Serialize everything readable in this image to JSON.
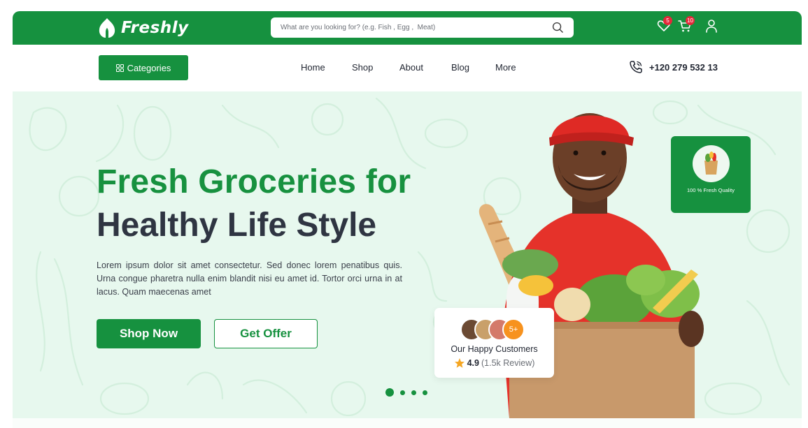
{
  "brand": {
    "name": "Freshly",
    "primary_color": "#16913f",
    "dark_text": "#2f3542",
    "badge_color": "#e5283a",
    "accent_orange": "#f7921e"
  },
  "header": {
    "search": {
      "placeholder": "What are you looking for? (e.g. Fish , Egg ,  Meat)",
      "icon": "search-icon"
    },
    "wishlist": {
      "icon": "heart-icon",
      "count": "5"
    },
    "cart": {
      "icon": "cart-icon",
      "count": "10"
    },
    "account": {
      "icon": "user-icon"
    }
  },
  "nav": {
    "categories_label": "Categories",
    "categories_icon": "grid-icon",
    "links": [
      "Home",
      "Shop",
      "About",
      "Blog",
      "More"
    ],
    "phone": "+120 279 532 13",
    "phone_icon": "phone-icon"
  },
  "hero": {
    "headline_line1": "Fresh Groceries for",
    "headline_line2": "Healthy Life Style",
    "description": "Lorem ipsum dolor sit amet consectetur. Sed donec lorem penatibus quis. Urna congue pharetra nulla enim blandit nisi eu amet id. Tortor orci urna in at lacus. Quam maecenas amet",
    "shop_now_label": "Shop Now",
    "get_offer_label": "Get Offer",
    "slides_count": 4,
    "active_slide": 1
  },
  "quality_badge": {
    "text": "100 % Fresh Quality",
    "icon": "grocery-bag-icon"
  },
  "customers_card": {
    "more_count": "5+",
    "title": "Our Happy Customers",
    "rating": "4.9",
    "reviews": "(1.5k Review)",
    "icon": "star-icon"
  }
}
